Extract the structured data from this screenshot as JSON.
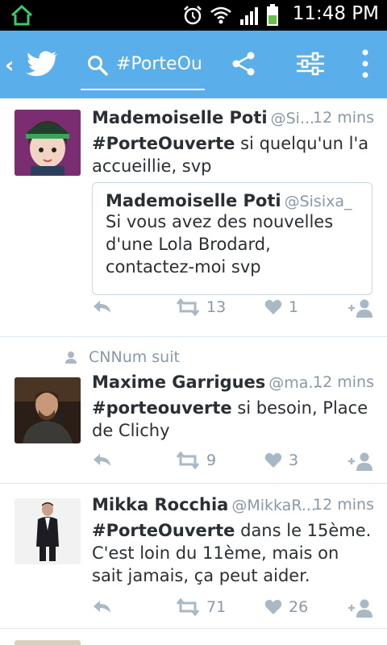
{
  "statusbar": {
    "time": "11:48 PM",
    "icons": [
      "home-icon",
      "alarm-icon",
      "wifi-icon",
      "signal-icon",
      "battery-icon"
    ]
  },
  "appbar": {
    "back_icon": "chevron-left-icon",
    "logo_icon": "twitter-bird-icon",
    "search_query": "#PorteOuverte",
    "share_icon": "share-icon",
    "filter_icon": "filter-icon",
    "more_icon": "more-vertical-icon",
    "color": "#5aaee9"
  },
  "tweets": [
    {
      "name": "Mademoiselle Poti",
      "handle": "@Si...",
      "time": "12 mins",
      "hashtag": "#PorteOuverte",
      "text_after": " si quelqu'un l'a accueillie, svp",
      "quote": {
        "name": "Mademoiselle Poti",
        "handle": "@Sisixa_",
        "text": "Si vous avez des nouvelles d'une Lola Brodard, contactez-moi svp"
      },
      "retweets": "13",
      "likes": "1"
    },
    {
      "social_context": "CNNum suit",
      "name": "Maxime Garrigues",
      "handle": "@ma...",
      "time": "12 mins",
      "hashtag": "#porteouverte",
      "text_after": " si besoin, Place de Clichy",
      "retweets": "9",
      "likes": "3"
    },
    {
      "name": "Mikka Rocchia",
      "handle": "@MikkaR...",
      "time": "12 mins",
      "hashtag": "#PorteOuverte",
      "text_after": " dans le 15ème. C'est loin du 11ème, mais on sait jamais, ça peut aider.",
      "retweets": "71",
      "likes": "26"
    }
  ]
}
